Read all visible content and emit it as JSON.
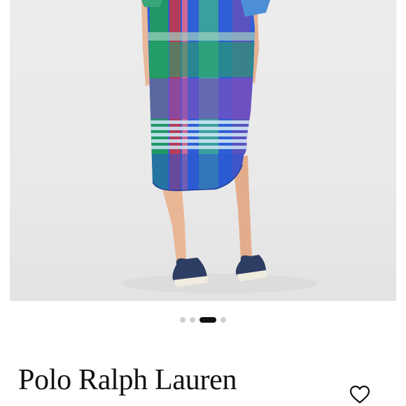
{
  "product": {
    "brand": "Polo Ralph Lauren",
    "image_icon": "product-photo-plaid-shirt-dress"
  },
  "carousel": {
    "total": 4,
    "active_index": 2
  },
  "actions": {
    "favorite_icon": "heart-outline-icon"
  },
  "colors": {
    "plaid_blue": "#2f5fd6",
    "plaid_green": "#1f9e5a",
    "plaid_purple": "#6b4fb8",
    "plaid_red": "#c23a4c",
    "shoe_navy": "#2e3d63"
  }
}
